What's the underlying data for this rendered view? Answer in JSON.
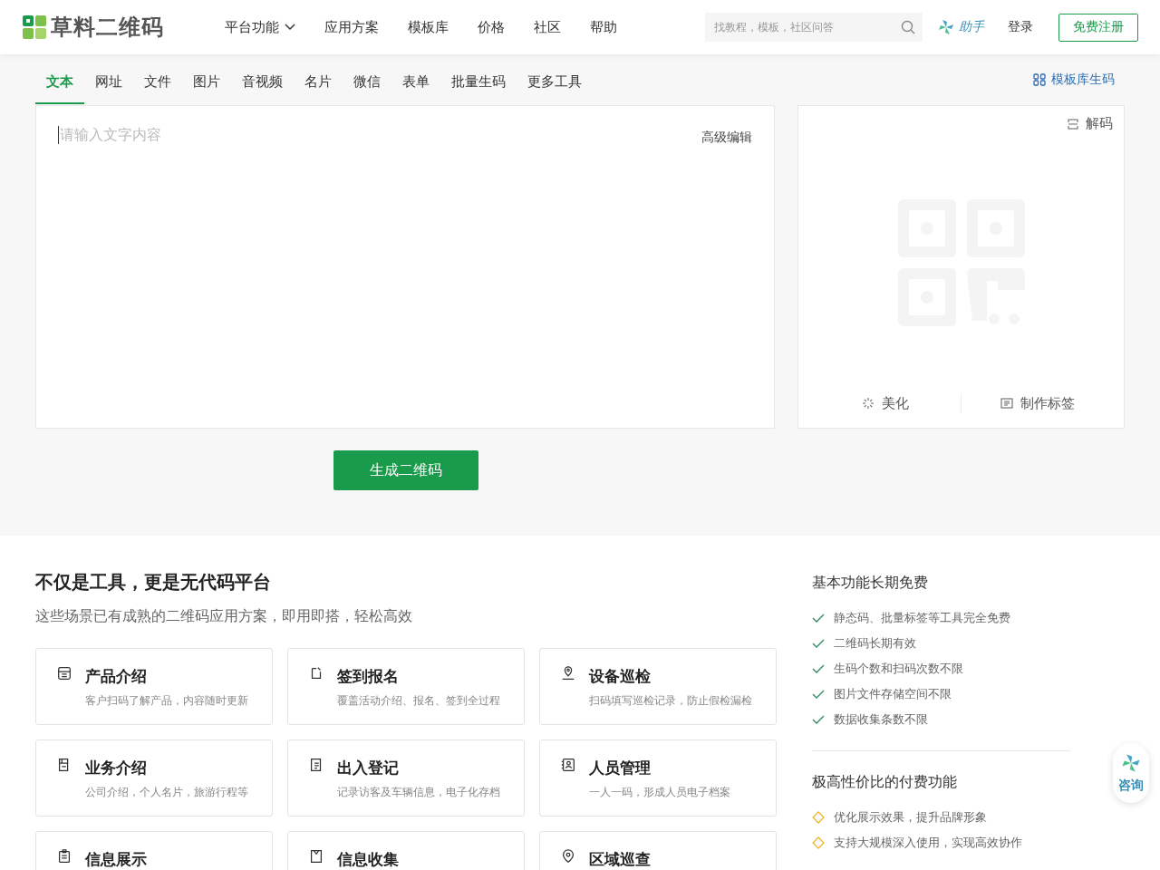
{
  "header": {
    "logo": "草料二维码",
    "nav": [
      {
        "label": "平台功能",
        "dropdown": true
      },
      {
        "label": "应用方案",
        "dropdown": false
      },
      {
        "label": "模板库",
        "dropdown": false
      },
      {
        "label": "价格",
        "dropdown": false
      },
      {
        "label": "社区",
        "dropdown": false
      },
      {
        "label": "帮助",
        "dropdown": false
      }
    ],
    "search": {
      "placeholder": "找教程，模板，社区问答"
    },
    "assistant": "助手",
    "login": "登录",
    "register": "免费注册"
  },
  "tabs": [
    {
      "label": "文本",
      "selected": true
    },
    {
      "label": "网址",
      "selected": false
    },
    {
      "label": "文件",
      "selected": false
    },
    {
      "label": "图片",
      "selected": false
    },
    {
      "label": "音视频",
      "selected": false
    },
    {
      "label": "名片",
      "selected": false
    },
    {
      "label": "微信",
      "selected": false
    },
    {
      "label": "表单",
      "selected": false
    },
    {
      "label": "批量生码",
      "selected": false
    },
    {
      "label": "更多工具",
      "selected": false
    }
  ],
  "template_link": "模板库生码",
  "editor": {
    "placeholder": "请输入文字内容",
    "advanced": "高级编辑"
  },
  "preview": {
    "decode": "解码",
    "actions": [
      "美化",
      "制作标签"
    ]
  },
  "generate_button": "生成二维码",
  "solutions": {
    "title": "不仅是工具，更是无代码平台",
    "subtitle": "这些场景已有成熟的二维码应用方案，即用即搭，轻松高效",
    "cards": [
      {
        "title": "产品介绍",
        "desc": "客户扫码了解产品，内容随时更新"
      },
      {
        "title": "签到报名",
        "desc": "覆盖活动介绍、报名、签到全过程"
      },
      {
        "title": "设备巡检",
        "desc": "扫码填写巡检记录，防止假检漏检"
      },
      {
        "title": "业务介绍",
        "desc": "公司介绍，个人名片，旅游行程等"
      },
      {
        "title": "出入登记",
        "desc": "记录访客及车辆信息，电子化存档"
      },
      {
        "title": "人员管理",
        "desc": "一人一码，形成人员电子档案"
      },
      {
        "title": "信息展示"
      },
      {
        "title": "信息收集"
      },
      {
        "title": "区域巡查"
      }
    ]
  },
  "features": {
    "free": {
      "title": "基本功能长期免费",
      "items": [
        "静态码、批量标签等工具完全免费",
        "二维码长期有效",
        "生码个数和扫码次数不限",
        "图片文件存储空间不限",
        "数据收集条数不限"
      ]
    },
    "paid": {
      "title": "极高性价比的付费功能",
      "items": [
        "优化展示效果，提升品牌形象",
        "支持大规模深入使用，实现高效协作"
      ]
    }
  },
  "consult": "咨询"
}
